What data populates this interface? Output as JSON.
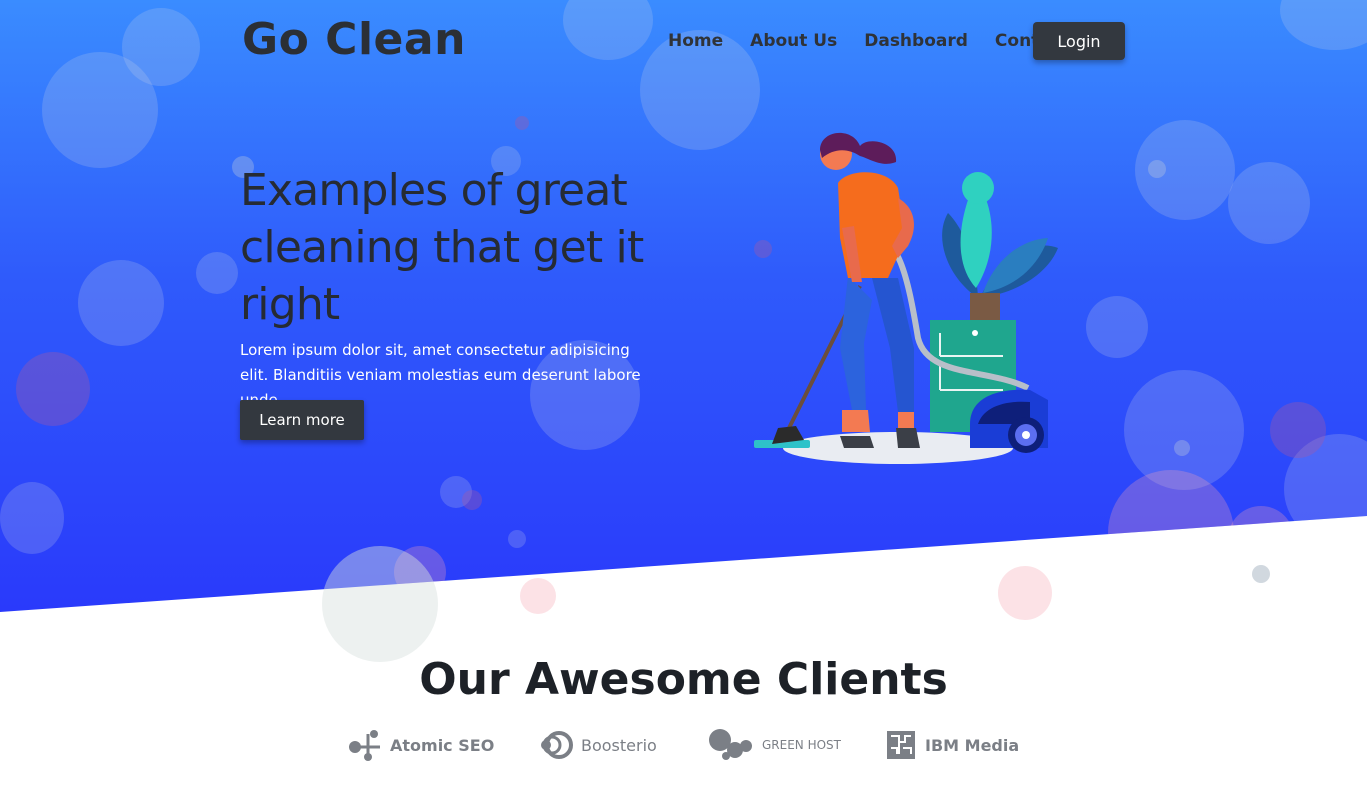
{
  "brand": {
    "name": "Go Clean"
  },
  "nav": {
    "items": [
      "Home",
      "About Us",
      "Dashboard",
      "Contact"
    ],
    "login_label": "Login"
  },
  "hero": {
    "headline": "Examples of great cleaning that get it right",
    "lead": "Lorem ipsum dolor sit, amet consectetur adipisicing elit. Blanditiis veniam molestias eum deserunt labore unde.",
    "cta_label": "Learn more",
    "illustration_icon": "woman-vacuuming-illustration"
  },
  "clients": {
    "title": "Our Awesome Clients",
    "logos": [
      {
        "name": "Atomic SEO",
        "icon": "atomic-seo-logo-icon"
      },
      {
        "name": "Boosterio",
        "icon": "boosterio-logo-icon"
      },
      {
        "name": "GREEN HOST",
        "icon": "green-host-logo-icon"
      },
      {
        "name": "IBM Media",
        "icon": "ibm-media-logo-icon"
      }
    ]
  },
  "colors": {
    "hero_top": "#3a8cff",
    "hero_bottom": "#2a3afb",
    "button_dark": "#33383f",
    "text_dark": "#262b33"
  }
}
